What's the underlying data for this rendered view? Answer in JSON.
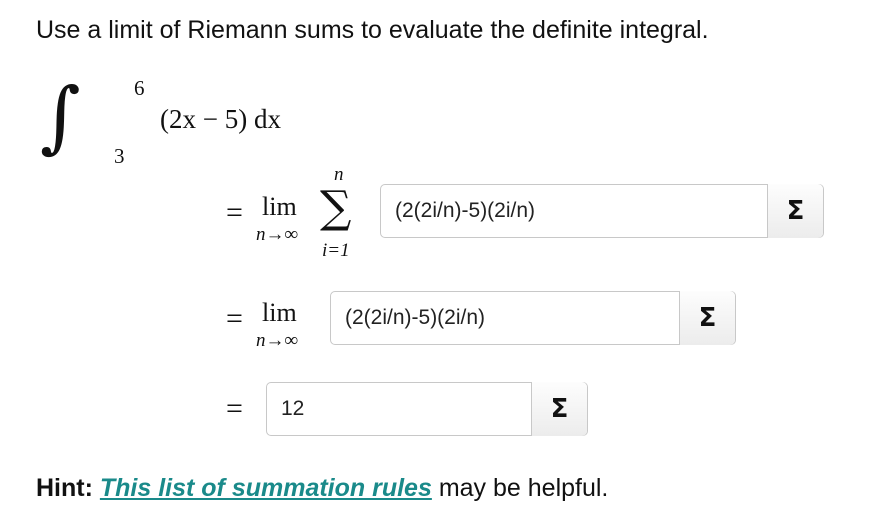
{
  "prompt": "Use a limit of Riemann sums to evaluate the definite integral.",
  "integral": {
    "upper": "6",
    "lower": "3",
    "integrand": "(2x − 5) dx"
  },
  "rows": [
    {
      "equals": "=",
      "lim": "lim",
      "lim_sub": "n→∞",
      "sum_upper": "n",
      "sum_lower": "i=1",
      "value": "(2(2i/n)-5)(2i/n)",
      "sigma_label": "Σ"
    },
    {
      "equals": "=",
      "lim": "lim",
      "lim_sub": "n→∞",
      "value": "(2(2i/n)-5)(2i/n)",
      "sigma_label": "Σ"
    },
    {
      "equals": "=",
      "value": "12",
      "sigma_label": "Σ"
    }
  ],
  "hint": {
    "label": "Hint:",
    "link_text": "This list of summation rules",
    "suffix": "may be helpful."
  }
}
